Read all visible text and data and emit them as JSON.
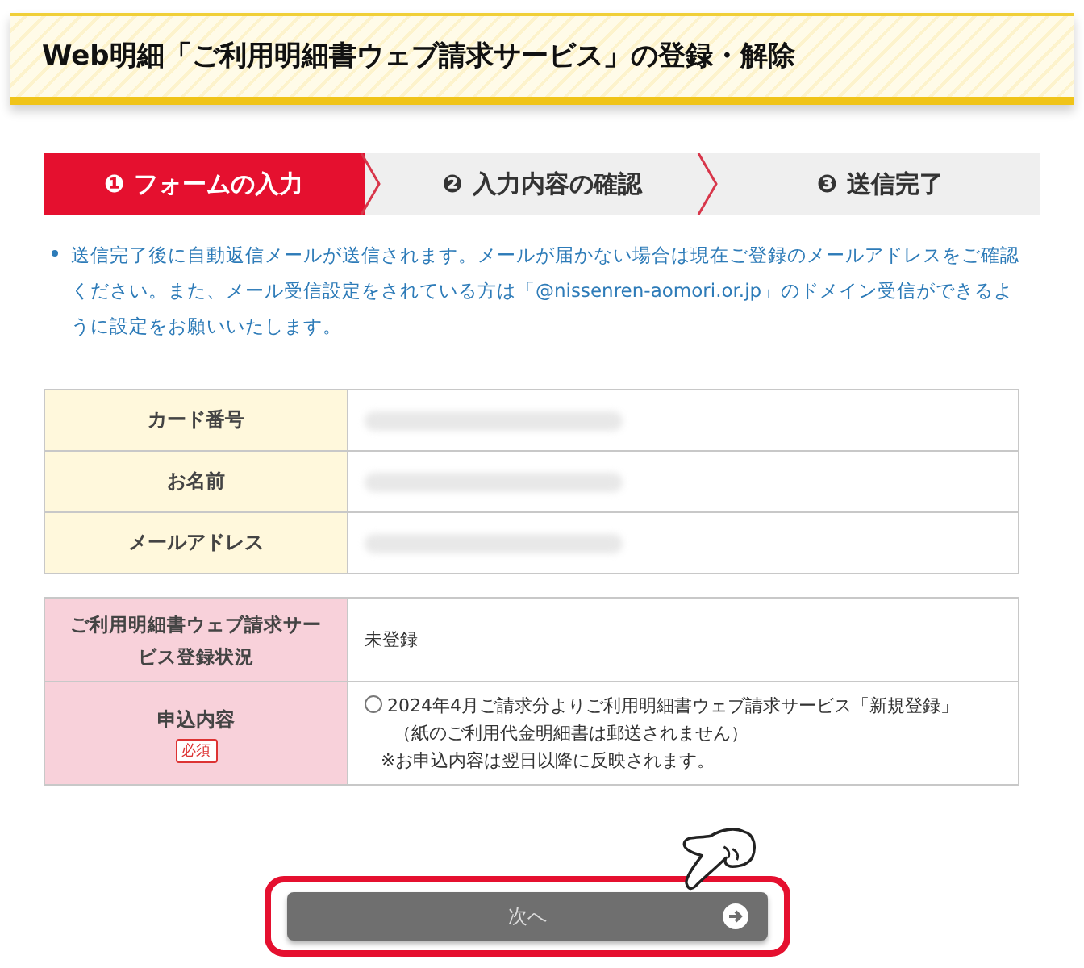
{
  "page_title": "Web明細「ご利用明細書ウェブ請求サービス」の登録・解除",
  "steps": [
    {
      "number": "❶",
      "label": "フォームの入力",
      "selected": true
    },
    {
      "number": "❷",
      "label": "入力内容の確認",
      "selected": false
    },
    {
      "number": "❸",
      "label": "送信完了",
      "selected": false
    }
  ],
  "notes": [
    "送信完了後に自動返信メールが送信されます。メールが届かない場合は現在ご登録のメールアドレスをご確認ください。また、メール受信設定をされている方は「@nissenren-aomori.or.jp」のドメイン受信ができるように設定をお願いいたします。"
  ],
  "member_table": {
    "rows": [
      {
        "label": "カード番号",
        "value_hidden": true
      },
      {
        "label": "お名前",
        "value_hidden": true
      },
      {
        "label": "メールアドレス",
        "value_hidden": true
      }
    ]
  },
  "service_table": {
    "rows": [
      {
        "kind": "text",
        "label": "ご利用明細書ウェブ請求サービス登録状況",
        "value": "未登録"
      },
      {
        "kind": "radio",
        "label": "申込内容",
        "badge": "必須",
        "options": [
          {
            "lines": [
              "2024年4月ご請求分よりご利用明細書ウェブ請求サービス「新規登録」",
              "（紙のご利用代金明細書は郵送されません）"
            ],
            "selected": false
          }
        ],
        "note": "※お申込内容は翌日以降に反映されます。"
      }
    ]
  },
  "next_button": {
    "label": "次へ",
    "disabled": true,
    "highlighted": true
  }
}
